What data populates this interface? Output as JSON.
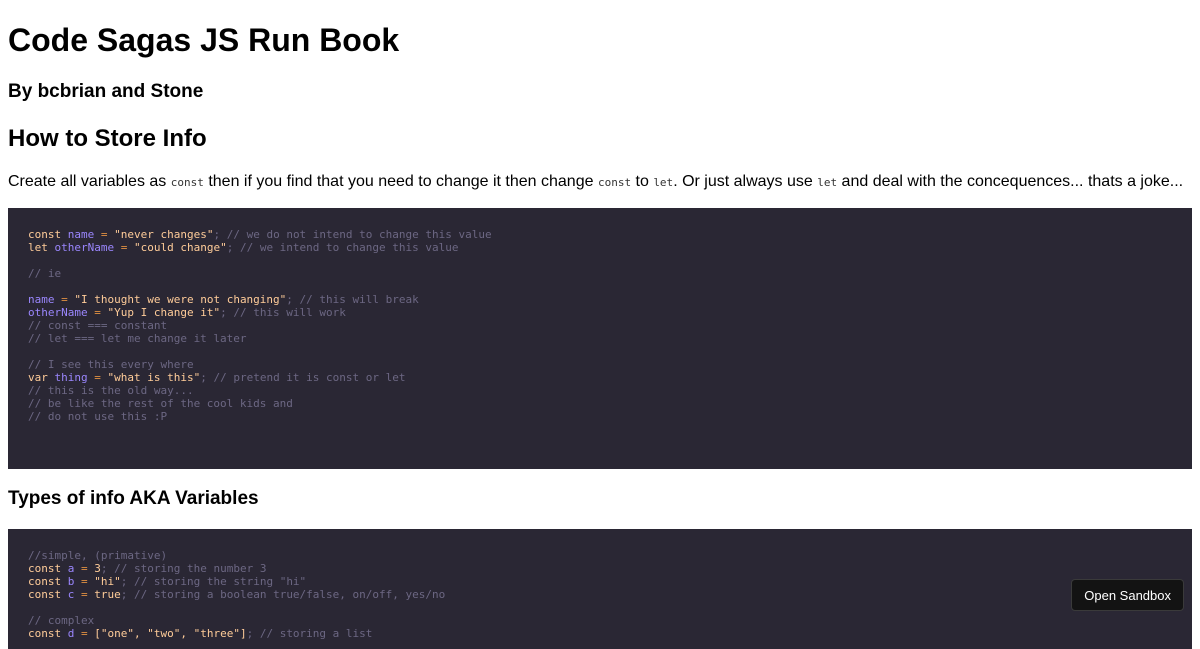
{
  "title": "Code Sagas JS Run Book",
  "byline": "By bcbrian and Stone",
  "section1": {
    "heading": "How to Store Info",
    "paragraph": [
      {
        "type": "text",
        "text": "Create all variables as "
      },
      {
        "type": "code",
        "text": "const"
      },
      {
        "type": "text",
        "text": " then if you find that you need to change it then change "
      },
      {
        "type": "code",
        "text": "const"
      },
      {
        "type": "text",
        "text": " to "
      },
      {
        "type": "code",
        "text": "let"
      },
      {
        "type": "text",
        "text": ". Or just always use "
      },
      {
        "type": "code",
        "text": "let"
      },
      {
        "type": "text",
        "text": " and deal with the concequences... thats a joke..."
      }
    ],
    "code": [
      [
        [
          "kw",
          "const "
        ],
        [
          "var",
          "name "
        ],
        [
          "op",
          "= "
        ],
        [
          "str",
          "\"never changes\""
        ],
        [
          "cm",
          "; // we do not intend to change this value"
        ]
      ],
      [
        [
          "kw",
          "let "
        ],
        [
          "var",
          "otherName "
        ],
        [
          "op",
          "= "
        ],
        [
          "str",
          "\"could change\""
        ],
        [
          "cm",
          "; // we intend to change this value"
        ]
      ],
      [],
      [
        [
          "cm",
          "// ie"
        ]
      ],
      [],
      [
        [
          "var",
          "name "
        ],
        [
          "op",
          "= "
        ],
        [
          "str",
          "\"I thought we were not changing\""
        ],
        [
          "cm",
          "; // this will break"
        ]
      ],
      [
        [
          "var",
          "otherName "
        ],
        [
          "op",
          "= "
        ],
        [
          "str",
          "\"Yup I change it\""
        ],
        [
          "cm",
          "; // this will work"
        ]
      ],
      [
        [
          "cm",
          "// const === constant"
        ]
      ],
      [
        [
          "cm",
          "// let === let me change it later"
        ]
      ],
      [],
      [
        [
          "cm",
          "// I see this every where"
        ]
      ],
      [
        [
          "kw",
          "var "
        ],
        [
          "pl",
          "thing "
        ],
        [
          "op",
          "= "
        ],
        [
          "str",
          "\"what is this\""
        ],
        [
          "cm",
          "; // pretend it is const or let"
        ]
      ],
      [
        [
          "cm",
          "// this is the old way..."
        ]
      ],
      [
        [
          "cm",
          "// be like the rest of the cool kids and"
        ]
      ],
      [
        [
          "cm",
          "// do not use this :P"
        ]
      ]
    ]
  },
  "section2": {
    "heading": "Types of info AKA Variables",
    "code": [
      [
        [
          "cm",
          "//simple, (primative)"
        ]
      ],
      [
        [
          "kw",
          "const "
        ],
        [
          "var",
          "a "
        ],
        [
          "op",
          "= "
        ],
        [
          "num",
          "3"
        ],
        [
          "cm",
          "; // storing the number 3"
        ]
      ],
      [
        [
          "kw",
          "const "
        ],
        [
          "var",
          "b "
        ],
        [
          "op",
          "= "
        ],
        [
          "str",
          "\"hi\""
        ],
        [
          "cm",
          "; // storing the string \"hi\""
        ]
      ],
      [
        [
          "kw",
          "const "
        ],
        [
          "var",
          "c "
        ],
        [
          "op",
          "= "
        ],
        [
          "num",
          "true"
        ],
        [
          "cm",
          "; // storing a boolean true/false, on/off, yes/no"
        ]
      ],
      [],
      [
        [
          "cm",
          "// complex"
        ]
      ],
      [
        [
          "kw",
          "const "
        ],
        [
          "var",
          "d "
        ],
        [
          "op",
          "= "
        ],
        [
          "str",
          "[\"one\", \"two\", \"three\"]"
        ],
        [
          "cm",
          "; // storing a list"
        ]
      ]
    ]
  },
  "sandbox_button": "Open Sandbox",
  "colors": {
    "code_bg": "#2a2734",
    "keyword": "#ffcc99",
    "variable": "#9a86fd",
    "operator": "#e09142",
    "comment": "#6c6783",
    "button_bg": "#131313"
  }
}
